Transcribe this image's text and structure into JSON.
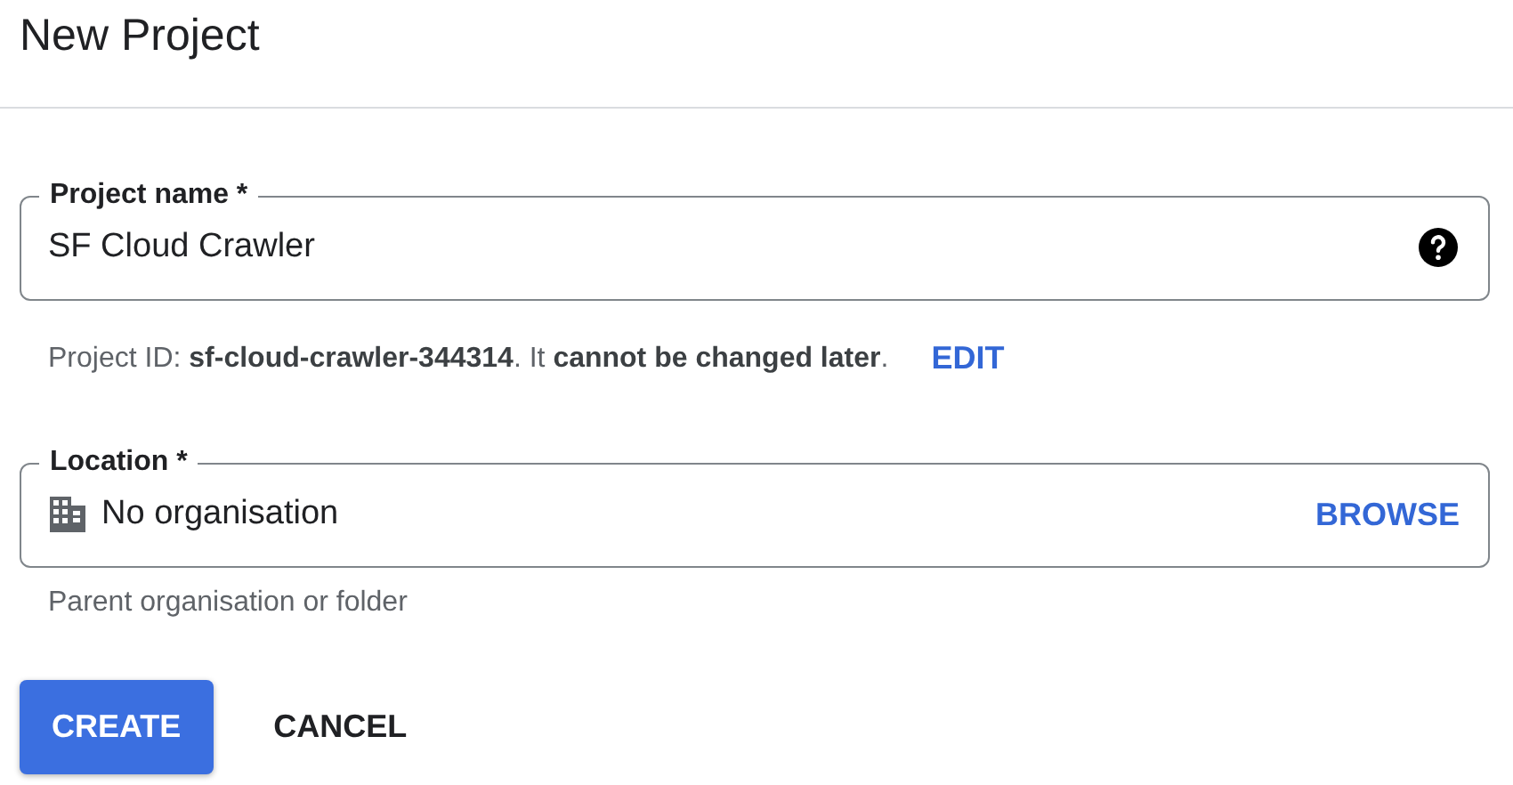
{
  "title": "New Project",
  "fields": [
    {
      "kind": "text",
      "label": "Project name *",
      "value": "SF Cloud Crawler",
      "help": "Project ID: **sf-cloud-crawler-344314**. It **cannot be changed later**.",
      "help_action": "EDIT"
    },
    {
      "kind": "picker",
      "label": "Location *",
      "value": "No organisation",
      "action": "BROWSE",
      "hint": "Parent organisation or folder"
    }
  ],
  "buttons": [
    {
      "label": "CREATE",
      "kind": "primary"
    },
    {
      "label": "CANCEL",
      "kind": "text"
    }
  ]
}
